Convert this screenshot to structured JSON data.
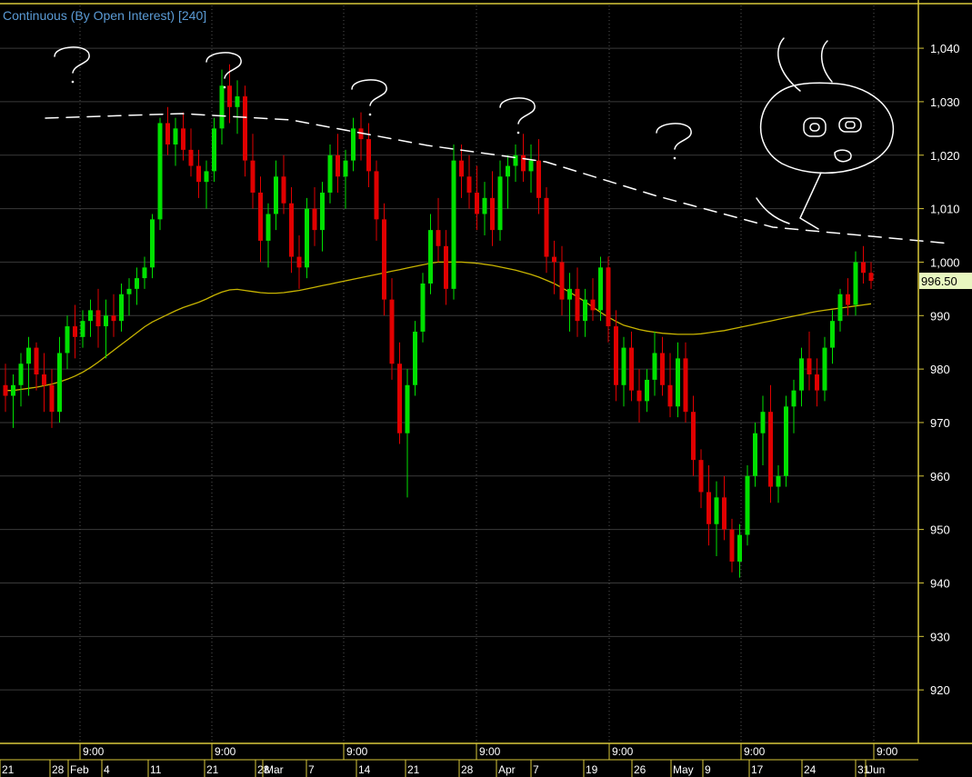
{
  "colors": {
    "background": "#000000",
    "grid": "#3a3a3a",
    "axis_frame": "#d8c83a",
    "up_candle": "#00e000",
    "down_candle": "#e00000",
    "moving_average": "#c8b400",
    "title": "#5b9bd5",
    "axis_text": "#ffffff",
    "price_tag_bg": "#e8f7c0",
    "drawing": "#ffffff"
  },
  "chart_data": {
    "type": "candlestick",
    "title": "Continuous (By Open Interest) [240]",
    "ylim": [
      910,
      1048
    ],
    "y_ticks": [
      920,
      930,
      940,
      950,
      960,
      970,
      980,
      990,
      1000,
      1010,
      1020,
      1030,
      1040
    ],
    "y_tick_labels": [
      "920",
      "930",
      "940",
      "950",
      "960",
      "970",
      "980",
      "990",
      "1,000",
      "1,010",
      "1,020",
      "1,030",
      "1,040"
    ],
    "last_price_label": "996.50",
    "last_price": 996.5,
    "x_time_labels": [
      "9:00",
      "9:00",
      "9:00",
      "9:00",
      "9:00",
      "9:00",
      "9:00"
    ],
    "x_date_labels": [
      "21",
      "28",
      "Feb",
      "4",
      "11",
      "21",
      "28",
      "Mar",
      "7",
      "14",
      "21",
      "28",
      "Apr",
      "7",
      "19",
      "26",
      "May",
      "9",
      "17",
      "24",
      "31",
      "Jun"
    ],
    "bars": [
      [
        977,
        981,
        972,
        975
      ],
      [
        975,
        979,
        969,
        977
      ],
      [
        977,
        983,
        973,
        981
      ],
      [
        981,
        986,
        975,
        984
      ],
      [
        984,
        985,
        976,
        979
      ],
      [
        979,
        983,
        972,
        977
      ],
      [
        977,
        980,
        969,
        972
      ],
      [
        972,
        986,
        970,
        983
      ],
      [
        983,
        990,
        980,
        988
      ],
      [
        988,
        992,
        982,
        986
      ],
      [
        986,
        991,
        984,
        989
      ],
      [
        989,
        993,
        986,
        991
      ],
      [
        991,
        995,
        984,
        988
      ],
      [
        988,
        993,
        982,
        990
      ],
      [
        990,
        994,
        986,
        989
      ],
      [
        989,
        996,
        987,
        994
      ],
      [
        994,
        997,
        990,
        995
      ],
      [
        995,
        999,
        992,
        997
      ],
      [
        997,
        1001,
        995,
        999
      ],
      [
        999,
        1009,
        997,
        1008
      ],
      [
        1008,
        1027,
        1006,
        1026
      ],
      [
        1026,
        1029,
        1020,
        1022
      ],
      [
        1022,
        1027,
        1018,
        1025
      ],
      [
        1025,
        1028,
        1019,
        1021
      ],
      [
        1021,
        1025,
        1016,
        1018
      ],
      [
        1018,
        1021,
        1012,
        1015
      ],
      [
        1015,
        1019,
        1010,
        1017
      ],
      [
        1017,
        1027,
        1015,
        1025
      ],
      [
        1025,
        1036,
        1022,
        1033
      ],
      [
        1033,
        1037,
        1026,
        1029
      ],
      [
        1029,
        1034,
        1024,
        1031
      ],
      [
        1031,
        1033,
        1016,
        1019
      ],
      [
        1019,
        1024,
        1010,
        1013
      ],
      [
        1013,
        1016,
        1000,
        1004
      ],
      [
        1004,
        1011,
        999,
        1009
      ],
      [
        1009,
        1019,
        1006,
        1016
      ],
      [
        1016,
        1020,
        1009,
        1011
      ],
      [
        1011,
        1014,
        998,
        1001
      ],
      [
        1001,
        1005,
        995,
        999
      ],
      [
        999,
        1012,
        997,
        1010
      ],
      [
        1010,
        1014,
        1003,
        1006
      ],
      [
        1006,
        1015,
        1002,
        1013
      ],
      [
        1013,
        1022,
        1011,
        1020
      ],
      [
        1020,
        1024,
        1013,
        1016
      ],
      [
        1016,
        1021,
        1010,
        1019
      ],
      [
        1019,
        1027,
        1017,
        1025
      ],
      [
        1025,
        1028,
        1019,
        1023
      ],
      [
        1023,
        1026,
        1014,
        1017
      ],
      [
        1017,
        1019,
        1004,
        1008
      ],
      [
        1008,
        1011,
        990,
        993
      ],
      [
        993,
        997,
        978,
        981
      ],
      [
        981,
        985,
        966,
        968
      ],
      [
        968,
        980,
        956,
        977
      ],
      [
        977,
        989,
        975,
        987
      ],
      [
        987,
        998,
        985,
        996
      ],
      [
        996,
        1009,
        994,
        1006
      ],
      [
        1006,
        1012,
        1000,
        1003
      ],
      [
        1003,
        1006,
        992,
        995
      ],
      [
        995,
        1022,
        993,
        1019
      ],
      [
        1019,
        1022,
        1012,
        1016
      ],
      [
        1016,
        1020,
        1010,
        1013
      ],
      [
        1013,
        1018,
        1006,
        1009
      ],
      [
        1009,
        1015,
        1005,
        1012
      ],
      [
        1012,
        1017,
        1003,
        1006
      ],
      [
        1006,
        1019,
        1004,
        1016
      ],
      [
        1016,
        1020,
        1010,
        1018
      ],
      [
        1018,
        1022,
        1015,
        1020
      ],
      [
        1020,
        1024,
        1015,
        1017
      ],
      [
        1017,
        1022,
        1013,
        1019
      ],
      [
        1019,
        1023,
        1009,
        1012
      ],
      [
        1012,
        1014,
        998,
        1001
      ],
      [
        1001,
        1004,
        994,
        1000
      ],
      [
        1000,
        1003,
        990,
        993
      ],
      [
        993,
        998,
        987,
        995
      ],
      [
        995,
        999,
        986,
        989
      ],
      [
        989,
        995,
        986,
        993
      ],
      [
        993,
        997,
        989,
        991
      ],
      [
        991,
        1001,
        989,
        999
      ],
      [
        999,
        1001,
        985,
        988
      ],
      [
        988,
        991,
        974,
        977
      ],
      [
        977,
        986,
        973,
        984
      ],
      [
        984,
        987,
        974,
        976
      ],
      [
        976,
        980,
        970,
        974
      ],
      [
        974,
        980,
        972,
        978
      ],
      [
        978,
        987,
        975,
        983
      ],
      [
        983,
        986,
        975,
        977
      ],
      [
        977,
        983,
        971,
        973
      ],
      [
        973,
        985,
        971,
        982
      ],
      [
        982,
        985,
        970,
        972
      ],
      [
        972,
        975,
        960,
        963
      ],
      [
        963,
        965,
        954,
        957
      ],
      [
        957,
        962,
        947,
        951
      ],
      [
        951,
        959,
        945,
        956
      ],
      [
        956,
        960,
        948,
        950
      ],
      [
        950,
        952,
        942,
        944
      ],
      [
        944,
        951,
        941,
        949
      ],
      [
        949,
        962,
        947,
        960
      ],
      [
        960,
        970,
        958,
        968
      ],
      [
        968,
        975,
        962,
        972
      ],
      [
        972,
        977,
        955,
        958
      ],
      [
        958,
        962,
        955,
        960
      ],
      [
        960,
        975,
        958,
        973
      ],
      [
        973,
        978,
        968,
        976
      ],
      [
        976,
        984,
        973,
        982
      ],
      [
        982,
        987,
        976,
        979
      ],
      [
        979,
        982,
        973,
        976
      ],
      [
        976,
        986,
        974,
        984
      ],
      [
        984,
        991,
        981,
        989
      ],
      [
        989,
        995,
        987,
        994
      ],
      [
        994,
        997,
        990,
        992
      ],
      [
        992,
        1002,
        990,
        1000
      ],
      [
        1000,
        1003,
        996,
        998
      ],
      [
        998,
        1000,
        995,
        996.5
      ]
    ],
    "moving_average": [
      976,
      976,
      976.2,
      976.4,
      976.6,
      976.9,
      977.2,
      977.6,
      978.1,
      978.7,
      979.4,
      980.3,
      981.3,
      982.4,
      983.5,
      984.6,
      985.7,
      986.8,
      987.9,
      988.8,
      989.5,
      990.2,
      990.9,
      991.5,
      992,
      992.5,
      993.1,
      993.8,
      994.4,
      994.8,
      994.9,
      994.7,
      994.5,
      994.3,
      994.2,
      994.2,
      994.3,
      994.5,
      994.7,
      995,
      995.3,
      995.6,
      995.9,
      996.2,
      996.5,
      996.8,
      997.1,
      997.4,
      997.7,
      998,
      998.3,
      998.6,
      998.9,
      999.2,
      999.5,
      999.8,
      1000,
      1000,
      1000,
      1000,
      999.9,
      999.8,
      999.6,
      999.4,
      999.1,
      998.8,
      998.5,
      998.1,
      997.7,
      997.2,
      996.6,
      996,
      995.2,
      994.4,
      993.5,
      992.6,
      991.6,
      990.6,
      989.7,
      988.9,
      988.2,
      987.8,
      987.4,
      987.1,
      986.9,
      986.7,
      986.6,
      986.5,
      986.5,
      986.5,
      986.6,
      986.8,
      987,
      987.2,
      987.5,
      987.8,
      988.1,
      988.4,
      988.7,
      989,
      989.3,
      989.6,
      989.9,
      990.2,
      990.5,
      990.8,
      991,
      991.2,
      991.4,
      991.6,
      991.8,
      992,
      992.2
    ]
  }
}
